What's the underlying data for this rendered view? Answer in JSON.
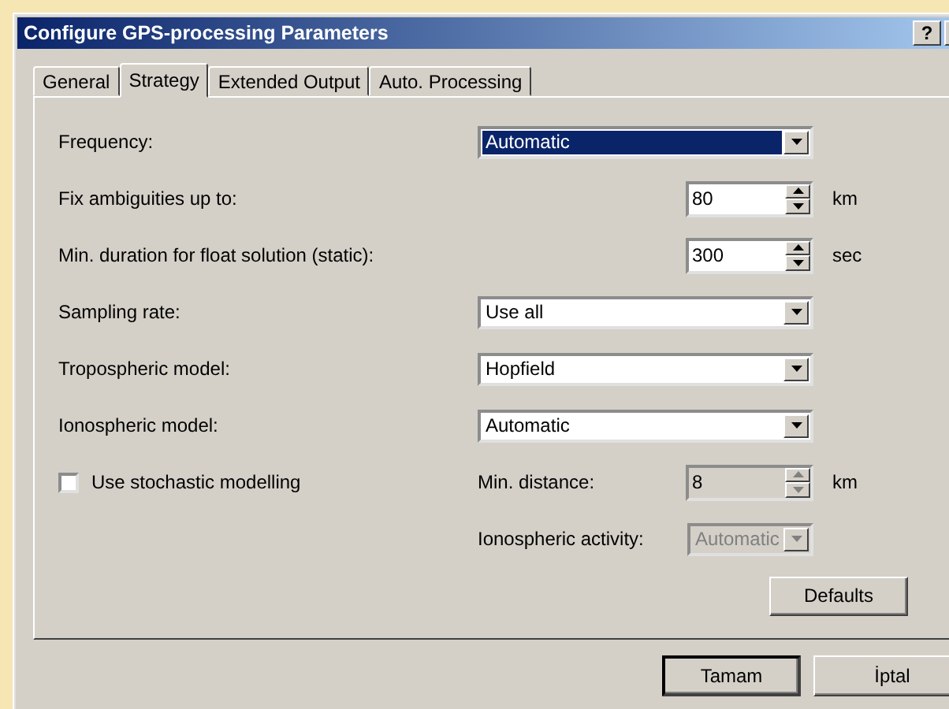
{
  "window": {
    "title": "Configure GPS-processing Parameters",
    "help_button": "?"
  },
  "tabs": [
    {
      "label": "General",
      "selected": false
    },
    {
      "label": "Strategy",
      "selected": true
    },
    {
      "label": "Extended Output",
      "selected": false
    },
    {
      "label": "Auto. Processing",
      "selected": false
    }
  ],
  "rows": [
    {
      "kind": "combo",
      "label": "Frequency:",
      "value": "Automatic",
      "focused": true
    },
    {
      "kind": "spin",
      "label": "Fix ambiguities up to:",
      "value": "80",
      "unit": "km"
    },
    {
      "kind": "spin",
      "label": "Min. duration for float solution (static):",
      "value": "300",
      "unit": "sec"
    },
    {
      "kind": "combo",
      "label": "Sampling rate:",
      "value": "Use all",
      "focused": false
    },
    {
      "kind": "combo",
      "label": "Tropospheric model:",
      "value": "Hopfield",
      "focused": false
    },
    {
      "kind": "combo",
      "label": "Ionospheric model:",
      "value": "Automatic",
      "focused": false
    }
  ],
  "stochastic": {
    "label": "Use stochastic modelling",
    "checked": false
  },
  "sub_rows": [
    {
      "kind": "spin",
      "label": "Min. distance:",
      "value": "8",
      "unit": "km",
      "disabled": true
    },
    {
      "kind": "combo",
      "label": "Ionospheric activity:",
      "value": "Automatic",
      "disabled": true
    }
  ],
  "defaults_button": "Defaults",
  "buttons": [
    {
      "label": "Tamam",
      "default": true
    },
    {
      "label": "İptal",
      "default": false
    }
  ]
}
